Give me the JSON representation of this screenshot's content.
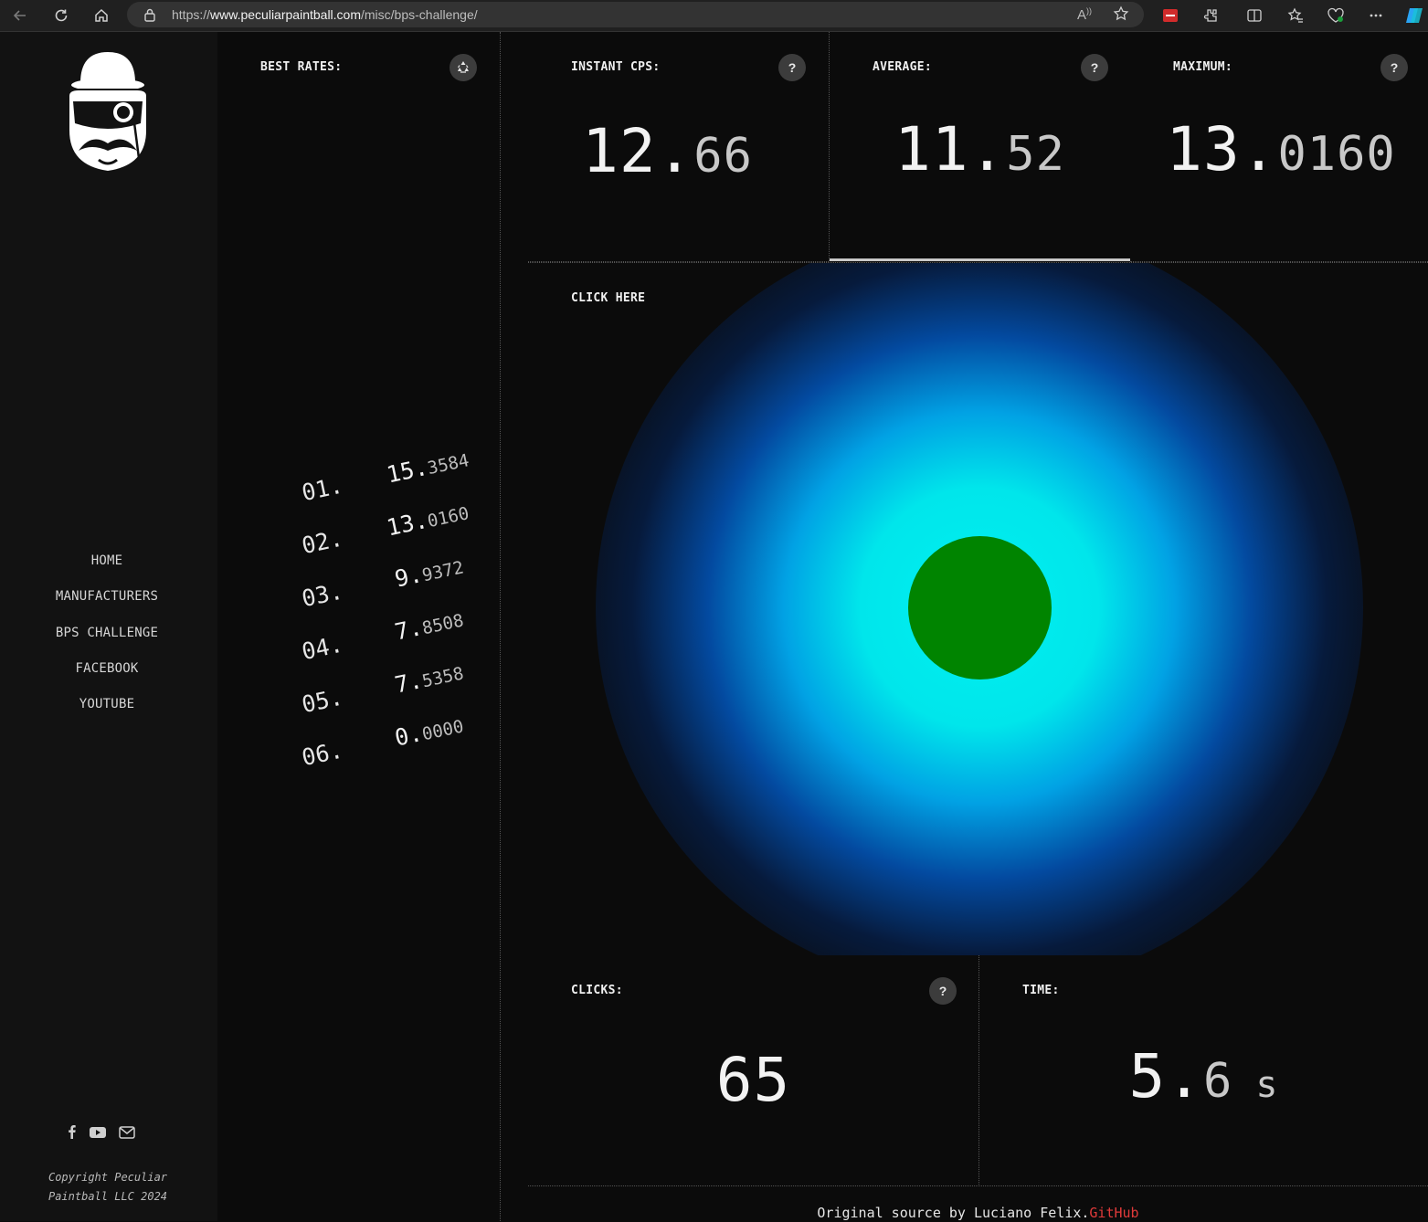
{
  "browser": {
    "url_prefix": "https://",
    "url_host": "www.peculiarpaintball.com",
    "url_path": "/misc/bps-challenge/"
  },
  "sidebar": {
    "menu": [
      "HOME",
      "MANUFACTURERS",
      "BPS CHALLENGE",
      "FACEBOOK",
      "YOUTUBE"
    ],
    "copyright": "Copyright Peculiar Paintball LLC 2024"
  },
  "best_rates": {
    "label": "BEST RATES:",
    "ranks": [
      {
        "rank": "01.",
        "int": "15.",
        "dec": "3584"
      },
      {
        "rank": "02.",
        "int": "13.",
        "dec": "0160"
      },
      {
        "rank": "03.",
        "int": "9.",
        "dec": "9372"
      },
      {
        "rank": "04.",
        "int": "7.",
        "dec": "8508"
      },
      {
        "rank": "05.",
        "int": "7.",
        "dec": "5358"
      },
      {
        "rank": "06.",
        "int": "0.",
        "dec": "0000"
      }
    ]
  },
  "stats": {
    "instant": {
      "label": "INSTANT CPS:",
      "int": "12.",
      "frac": "66"
    },
    "average": {
      "label": "AVERAGE:",
      "int": "11.",
      "frac": "52"
    },
    "maximum": {
      "label": "MAXIMUM:",
      "int": "13.",
      "frac": "0160"
    },
    "clicks": {
      "label": "CLICKS:",
      "value": "65"
    },
    "time": {
      "label": "TIME:",
      "int": "5.",
      "frac": "6",
      "unit": " s"
    }
  },
  "click_area": {
    "label": "CLICK HERE",
    "target_color": "#008400"
  },
  "help_glyph": "?",
  "footer": {
    "text": "Original source by Luciano Felix.",
    "link": "GitHub",
    "link_color": "#e03a3a"
  }
}
